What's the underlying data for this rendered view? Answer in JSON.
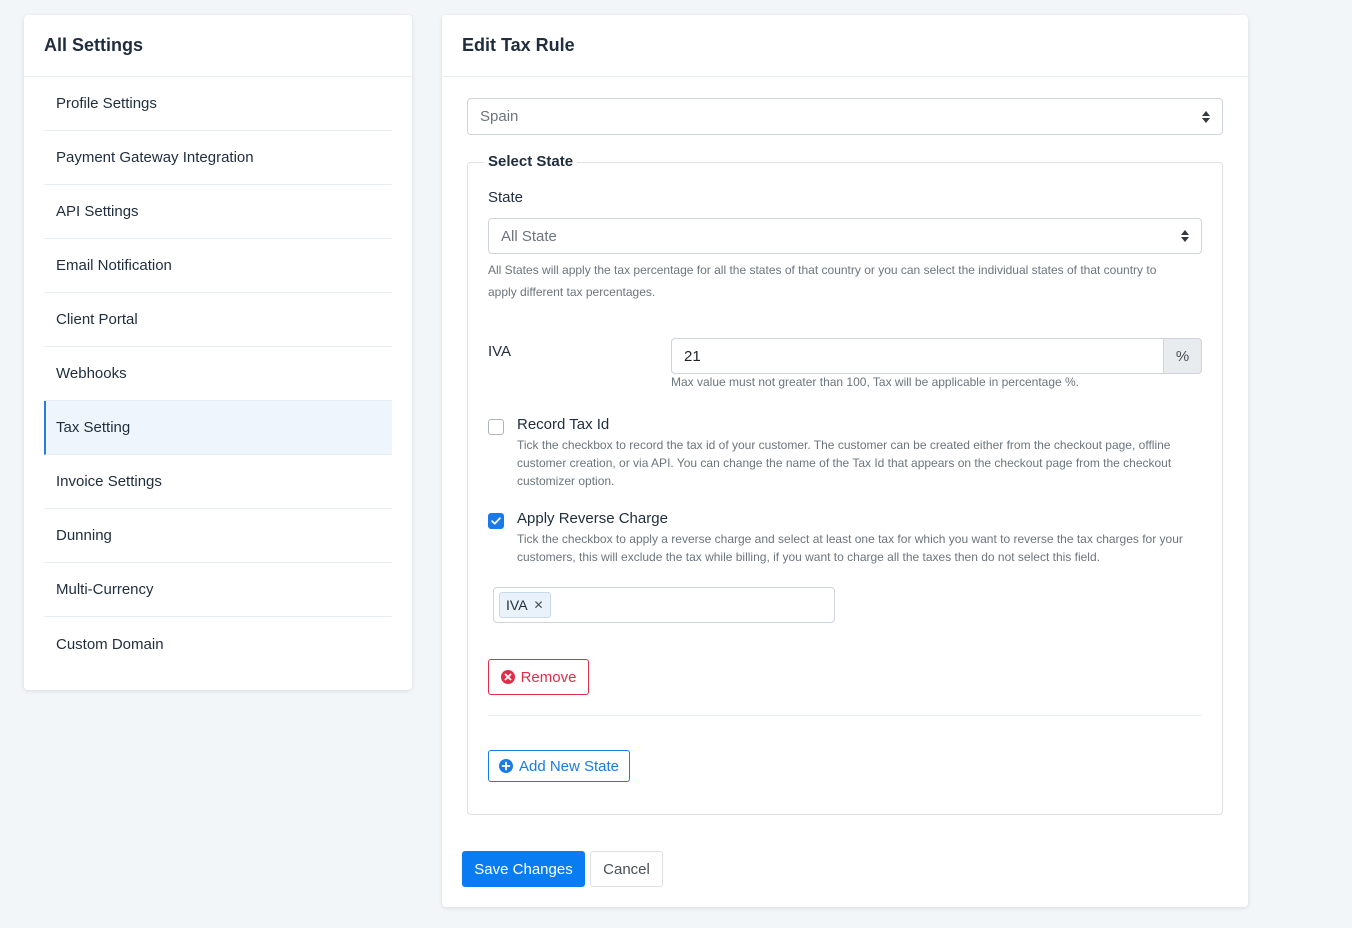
{
  "sidebar": {
    "title": "All Settings",
    "items": [
      {
        "label": "Profile Settings"
      },
      {
        "label": "Payment Gateway Integration"
      },
      {
        "label": "API Settings"
      },
      {
        "label": "Email Notification"
      },
      {
        "label": "Client Portal"
      },
      {
        "label": "Webhooks"
      },
      {
        "label": "Tax Setting"
      },
      {
        "label": "Invoice Settings"
      },
      {
        "label": "Dunning"
      },
      {
        "label": "Multi-Currency"
      },
      {
        "label": "Custom Domain"
      }
    ],
    "active_item": "Tax Setting"
  },
  "main": {
    "title": "Edit Tax Rule",
    "country_select": {
      "value": "Spain"
    },
    "state_section": {
      "legend": "Select State",
      "state_label": "State",
      "state_select": {
        "value": "All State"
      },
      "state_help": "All States will apply the tax percentage for all the states of that country or you can select the individual states of that country to apply different tax percentages.",
      "tax_label": "IVA",
      "tax_value": "21",
      "tax_unit": "%",
      "tax_help": "Max value must not greater than 100, Tax will be applicable in percentage %.",
      "record_tax_id": {
        "label": "Record Tax Id",
        "checked": false,
        "help": "Tick the checkbox to record the tax id of your customer. The customer can be created either from the checkout page, offline customer creation, or via API. You can change the name of the Tax Id that appears on the checkout page from the checkout customizer option."
      },
      "reverse_charge": {
        "label": "Apply Reverse Charge",
        "checked": true,
        "help": "Tick the checkbox to apply a reverse charge and select at least one tax for which you want to reverse the tax charges for your customers, this will exclude the tax while billing, if you want to charge all the taxes then do not select this field.",
        "tags": [
          "IVA"
        ]
      },
      "remove_label": "Remove",
      "add_state_label": "Add New State"
    },
    "save_label": "Save Changes",
    "cancel_label": "Cancel"
  },
  "colors": {
    "primary": "#0a7cf2",
    "danger": "#e02d4a",
    "active_bg": "#eef5fc",
    "background": "#f3f6f9"
  }
}
